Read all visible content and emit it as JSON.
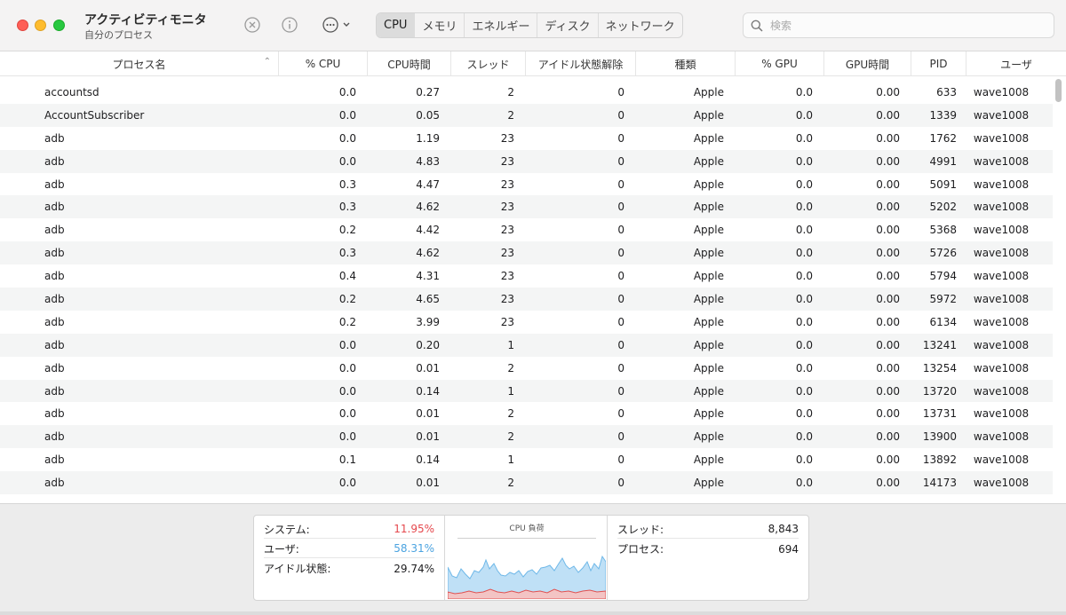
{
  "window": {
    "title": "アクティビティモニタ",
    "subtitle": "自分のプロセス"
  },
  "toolbar": {
    "stop_icon": "stop-process-icon",
    "info_icon": "info-icon",
    "more_icon": "ellipsis-icon",
    "tabs": [
      {
        "label": "CPU",
        "active": true
      },
      {
        "label": "メモリ",
        "active": false
      },
      {
        "label": "エネルギー",
        "active": false
      },
      {
        "label": "ディスク",
        "active": false
      },
      {
        "label": "ネットワーク",
        "active": false
      }
    ],
    "search": {
      "placeholder": "検索",
      "value": ""
    }
  },
  "table": {
    "columns": [
      "プロセス名",
      "% CPU",
      "CPU時間",
      "スレッド",
      "アイドル状態解除",
      "種類",
      "% GPU",
      "GPU時間",
      "PID",
      "ユーザ"
    ],
    "rows": [
      [
        "accountsd",
        "0.0",
        "0.27",
        "2",
        "0",
        "Apple",
        "0.0",
        "0.00",
        "633",
        "wave1008"
      ],
      [
        "AccountSubscriber",
        "0.0",
        "0.05",
        "2",
        "0",
        "Apple",
        "0.0",
        "0.00",
        "1339",
        "wave1008"
      ],
      [
        "adb",
        "0.0",
        "1.19",
        "23",
        "0",
        "Apple",
        "0.0",
        "0.00",
        "1762",
        "wave1008"
      ],
      [
        "adb",
        "0.0",
        "4.83",
        "23",
        "0",
        "Apple",
        "0.0",
        "0.00",
        "4991",
        "wave1008"
      ],
      [
        "adb",
        "0.3",
        "4.47",
        "23",
        "0",
        "Apple",
        "0.0",
        "0.00",
        "5091",
        "wave1008"
      ],
      [
        "adb",
        "0.3",
        "4.62",
        "23",
        "0",
        "Apple",
        "0.0",
        "0.00",
        "5202",
        "wave1008"
      ],
      [
        "adb",
        "0.2",
        "4.42",
        "23",
        "0",
        "Apple",
        "0.0",
        "0.00",
        "5368",
        "wave1008"
      ],
      [
        "adb",
        "0.3",
        "4.62",
        "23",
        "0",
        "Apple",
        "0.0",
        "0.00",
        "5726",
        "wave1008"
      ],
      [
        "adb",
        "0.4",
        "4.31",
        "23",
        "0",
        "Apple",
        "0.0",
        "0.00",
        "5794",
        "wave1008"
      ],
      [
        "adb",
        "0.2",
        "4.65",
        "23",
        "0",
        "Apple",
        "0.0",
        "0.00",
        "5972",
        "wave1008"
      ],
      [
        "adb",
        "0.2",
        "3.99",
        "23",
        "0",
        "Apple",
        "0.0",
        "0.00",
        "6134",
        "wave1008"
      ],
      [
        "adb",
        "0.0",
        "0.20",
        "1",
        "0",
        "Apple",
        "0.0",
        "0.00",
        "13241",
        "wave1008"
      ],
      [
        "adb",
        "0.0",
        "0.01",
        "2",
        "0",
        "Apple",
        "0.0",
        "0.00",
        "13254",
        "wave1008"
      ],
      [
        "adb",
        "0.0",
        "0.14",
        "1",
        "0",
        "Apple",
        "0.0",
        "0.00",
        "13720",
        "wave1008"
      ],
      [
        "adb",
        "0.0",
        "0.01",
        "2",
        "0",
        "Apple",
        "0.0",
        "0.00",
        "13731",
        "wave1008"
      ],
      [
        "adb",
        "0.0",
        "0.01",
        "2",
        "0",
        "Apple",
        "0.0",
        "0.00",
        "13900",
        "wave1008"
      ],
      [
        "adb",
        "0.1",
        "0.14",
        "1",
        "0",
        "Apple",
        "0.0",
        "0.00",
        "13892",
        "wave1008"
      ],
      [
        "adb",
        "0.0",
        "0.01",
        "2",
        "0",
        "Apple",
        "0.0",
        "0.00",
        "14173",
        "wave1008"
      ]
    ]
  },
  "summary": {
    "system_label": "システム:",
    "system_value": "11.95%",
    "user_label": "ユーザ:",
    "user_value": "58.31%",
    "idle_label": "アイドル状態:",
    "idle_value": "29.74%",
    "chart_title": "CPU 負荷",
    "threads_label": "スレッド:",
    "threads_value": "8,843",
    "processes_label": "プロセス:",
    "processes_value": "694"
  },
  "colors": {
    "system": "#e5484d",
    "user": "#4ba3e0"
  }
}
